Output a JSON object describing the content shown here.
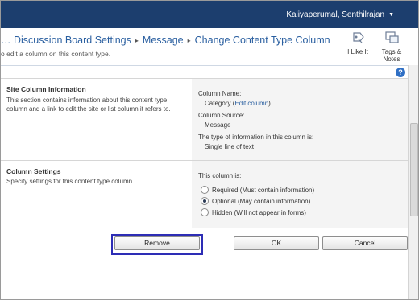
{
  "user": {
    "name": "Kaliyaperumal, Senthilrajan",
    "caret": "▼"
  },
  "breadcrumb": [
    "… Discussion Board Settings",
    "Message",
    "Change Content Type Column"
  ],
  "breadcrumb_sep": "▸",
  "subtitle": "o edit a column on this content type.",
  "actions": {
    "like_label": "I Like It",
    "tags_label": "Tags & Notes"
  },
  "help_glyph": "?",
  "site_column": {
    "title": "Site Column Information",
    "description": "This section contains information about this content type column and a link to edit the site or list column it refers to.",
    "column_name_label": "Column Name:",
    "column_name_value": "Category",
    "edit_link": "Edit column",
    "paren_open": "(",
    "paren_close": ")",
    "column_source_label": "Column Source:",
    "column_source_value": "Message",
    "type_label": "The type of information in this column is:",
    "type_value": "Single line of text"
  },
  "column_settings": {
    "title": "Column Settings",
    "description": "Specify settings for this content type column.",
    "prompt": "This column is:",
    "options": [
      {
        "label": "Required (Must contain information)",
        "selected": false
      },
      {
        "label": "Optional (May contain information)",
        "selected": true
      },
      {
        "label": "Hidden (Will not appear in forms)",
        "selected": false
      }
    ]
  },
  "buttons": {
    "remove": "Remove",
    "ok": "OK",
    "cancel": "Cancel"
  },
  "colors": {
    "topbar": "#1c3e6e",
    "link": "#2a5fa0",
    "highlight": "#2d2db5"
  }
}
